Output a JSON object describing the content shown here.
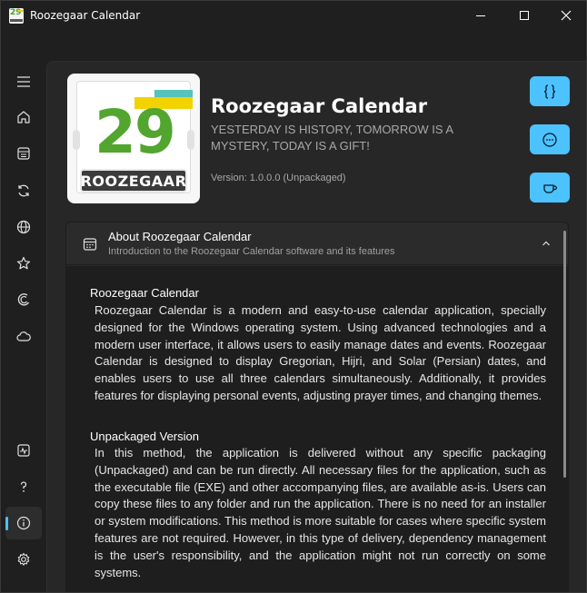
{
  "window": {
    "title": "Roozegaar Calendar",
    "controls": {
      "minimize": "minimize-icon",
      "maximize": "maximize-icon",
      "close": "close-icon"
    }
  },
  "sidebar": {
    "items": [
      {
        "icon": "hamburger-menu-icon"
      },
      {
        "icon": "home-icon"
      },
      {
        "icon": "calendar-icon"
      },
      {
        "icon": "sync-icon"
      },
      {
        "icon": "globe-icon"
      },
      {
        "icon": "star-icon"
      },
      {
        "icon": "crescent-icon"
      },
      {
        "icon": "cloud-icon"
      },
      {
        "icon": "activity-icon"
      },
      {
        "icon": "help-icon"
      },
      {
        "icon": "info-icon",
        "active": true
      },
      {
        "icon": "settings-icon"
      }
    ]
  },
  "header": {
    "logo": {
      "number": "29",
      "label": "ROOZEGAAR"
    },
    "title": "Roozegaar Calendar",
    "tagline": "YESTERDAY IS HISTORY, TOMORROW IS A MYSTERY, TODAY IS A GIFT!",
    "version": "Version: 1.0.0.0 (Unpackaged)",
    "actions": [
      {
        "icon": "code-braces-icon"
      },
      {
        "icon": "chat-bubble-icon"
      },
      {
        "icon": "coffee-cup-icon"
      }
    ]
  },
  "about": {
    "title": "About Roozegaar Calendar",
    "subtitle": "Introduction to the Roozegaar Calendar software and its features",
    "sections": [
      {
        "title": "Roozegaar Calendar",
        "text": "Roozegaar Calendar is a modern and easy-to-use calendar application, specially designed for the Windows operating system. Using advanced technologies and a modern user interface, it allows users to easily manage dates and events. Roozegaar Calendar is designed to display Gregorian, Hijri, and Solar (Persian) dates, and enables users to use all three calendars simultaneously. Additionally, it provides features for displaying personal events, adjusting prayer times, and changing themes."
      },
      {
        "title": "Unpackaged Version",
        "text": "In this method, the application is delivered without any specific packaging (Unpackaged) and can be run directly. All necessary files for the application, such as the executable file (EXE) and other accompanying files, are available as-is. Users can copy these files to any folder and run the application. There is no need for an installer or system modifications. This method is more suitable for cases where specific system features are not required. However, in this type of delivery, dependency management is the user's responsibility, and the application might not run correctly on some systems."
      }
    ]
  },
  "colors": {
    "accent": "#4cc2ff",
    "window_bg": "#1f1f1f",
    "card_bg": "#2b2b2b",
    "logo_green": "#52a52e",
    "logo_yellow": "#f2d300",
    "logo_teal": "#55c2bc"
  }
}
